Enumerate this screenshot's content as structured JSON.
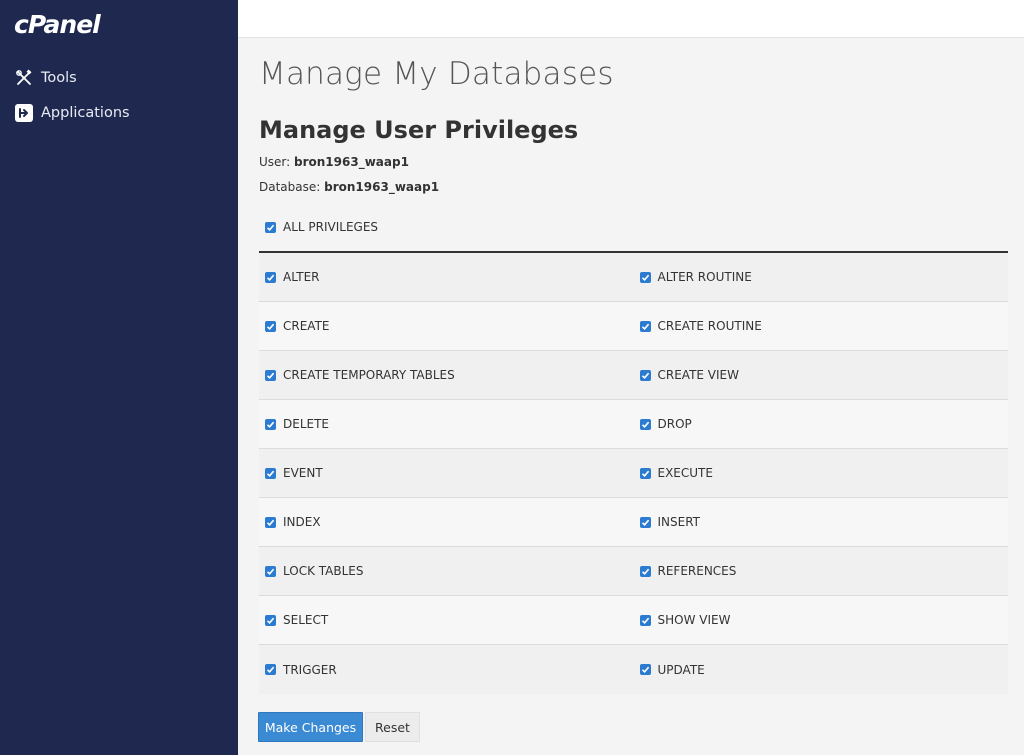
{
  "sidebar": {
    "logo": "cPanel",
    "items": [
      {
        "label": "Tools",
        "icon": "tools-icon"
      },
      {
        "label": "Applications",
        "icon": "applications-icon"
      }
    ]
  },
  "main": {
    "page_title": "Manage My Databases",
    "section_title": "Manage User Privileges",
    "user_label": "User:",
    "user_value": "bron1963_waap1",
    "database_label": "Database:",
    "database_value": "bron1963_waap1",
    "all_privileges": {
      "label": "ALL PRIVILEGES",
      "checked": true
    },
    "privileges": [
      [
        "ALTER",
        "ALTER ROUTINE"
      ],
      [
        "CREATE",
        "CREATE ROUTINE"
      ],
      [
        "CREATE TEMPORARY TABLES",
        "CREATE VIEW"
      ],
      [
        "DELETE",
        "DROP"
      ],
      [
        "EVENT",
        "EXECUTE"
      ],
      [
        "INDEX",
        "INSERT"
      ],
      [
        "LOCK TABLES",
        "REFERENCES"
      ],
      [
        "SELECT",
        "SHOW VIEW"
      ],
      [
        "TRIGGER",
        "UPDATE"
      ]
    ],
    "buttons": {
      "make_changes": "Make Changes",
      "reset": "Reset"
    }
  },
  "colors": {
    "sidebar_bg": "#1f2950",
    "accent": "#3b8ad4",
    "checkbox": "#2b7bd0"
  }
}
